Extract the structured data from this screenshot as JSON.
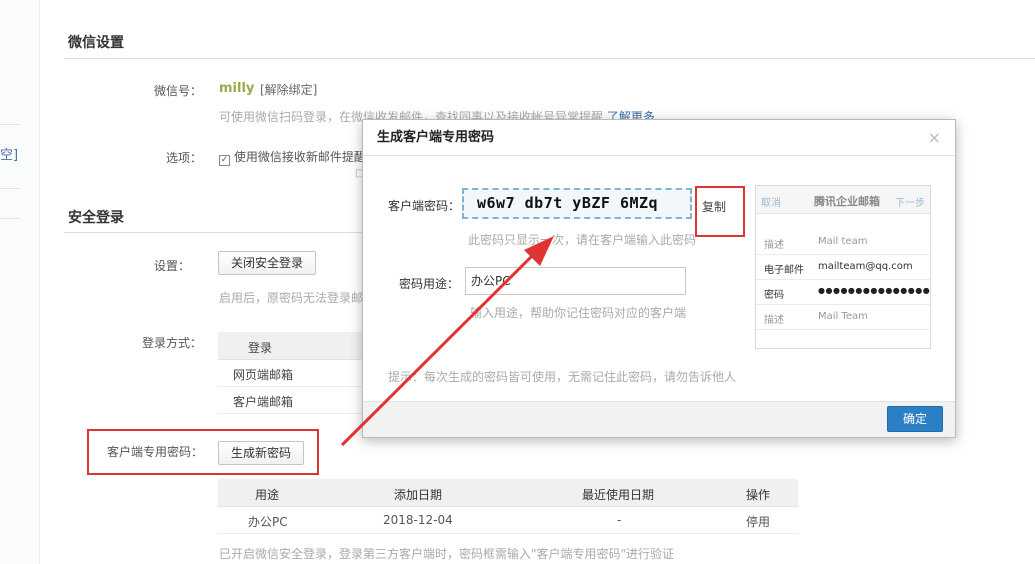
{
  "left_fragment": {
    "text": "空]"
  },
  "wechat_section": {
    "title": "微信设置",
    "wechat_id_label": "微信号：",
    "wechat_id_value": "milly",
    "unbind_link": "[解除绑定]",
    "hint": "可使用微信扫码登录，在微信收发邮件，查找同事以及接收帐号异常提醒",
    "learn_more": "了解更多",
    "options_label": "选项：",
    "option_checkbox_label": "使用微信接收新邮件提醒"
  },
  "security_section": {
    "title": "安全登录",
    "settings_label": "设置：",
    "close_button": "关闭安全登录",
    "hint": "启用后，原密码无法登录邮",
    "login_method_label": "登录方式：",
    "login_table_header": "登录",
    "login_rows": [
      "网页端邮箱",
      "客户端邮箱"
    ],
    "client_pwd_label": "客户端专用密码：",
    "generate_button": "生成新密码",
    "pwd_table": {
      "headers": [
        "用途",
        "添加日期",
        "最近使用日期",
        "操作"
      ],
      "rows": [
        {
          "use": "办公PC",
          "added": "2018-12-04",
          "last_used": "-",
          "action": "停用"
        }
      ]
    },
    "footer_hint": "已开启微信安全登录，登录第三方客户端时，密码框需输入\"客户端专用密码\"进行验证"
  },
  "dialog": {
    "title": "生成客户端专用密码",
    "close_glyph": "×",
    "pwd_label": "客户端密码：",
    "pwd_value": "w6w7 db7t yBZF 6MZq",
    "copy_label": "复制",
    "pwd_hint": "此密码只显示一次，请在客户端输入此密码",
    "purpose_label": "密码用途：",
    "purpose_value": "办公PC",
    "purpose_hint": "输入用途，帮助你记住密码对应的客户端",
    "tip": "提示：每次生成的密码皆可使用，无需记住此密码，请勿告诉他人",
    "ok_button": "确定",
    "preview": {
      "cancel": "取消",
      "title": "腾讯企业邮箱",
      "next": "下一步",
      "rows": [
        {
          "label": "描述",
          "value": "Mail team"
        },
        {
          "label": "电子邮件",
          "value": "mailteam@qq.com"
        },
        {
          "label": "密码",
          "value": "●●●●●●●●●●●●●●●"
        },
        {
          "label": "描述",
          "value": "Mail Team"
        }
      ]
    }
  },
  "colors": {
    "accent": "#2b7fc5",
    "highlight_red": "#e03434",
    "wechat_green": "#9aa94b",
    "link": "#3a6dae"
  }
}
